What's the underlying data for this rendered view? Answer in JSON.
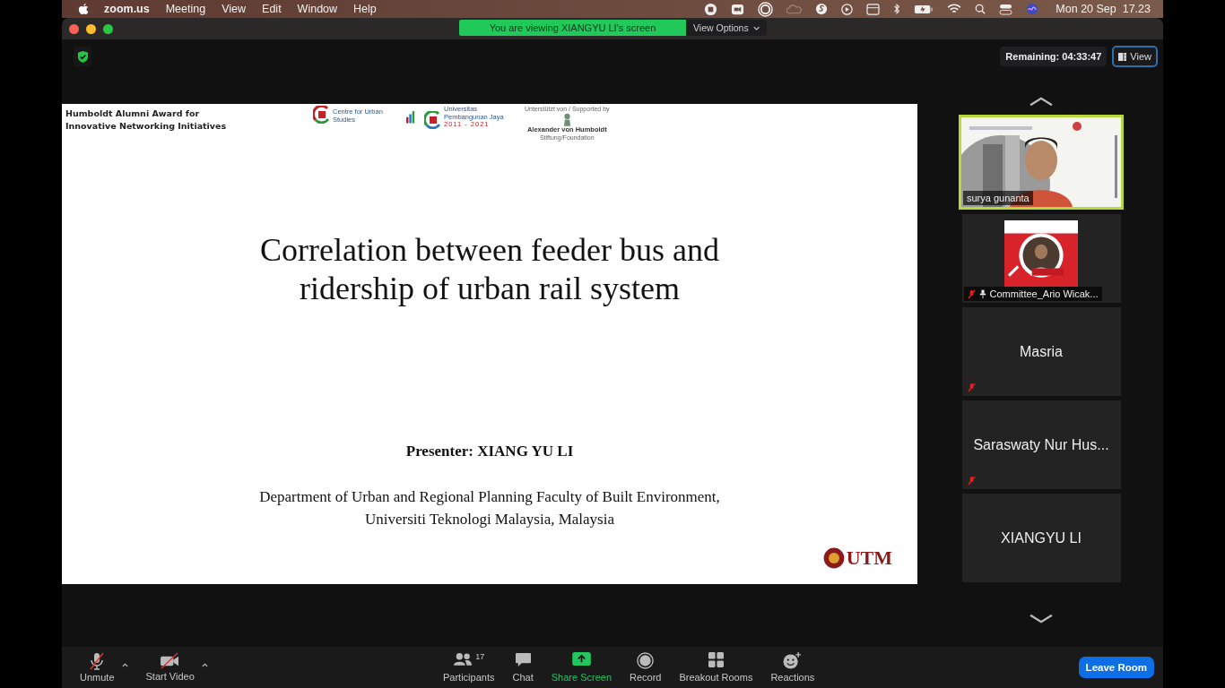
{
  "menu_bar": {
    "app_name": "zoom.us",
    "menus": [
      "Meeting",
      "View",
      "Edit",
      "Window",
      "Help"
    ],
    "clock": "Mon 20 Sep  17.23"
  },
  "banner": {
    "text": "You are viewing XIANGYU LI's screen",
    "view_options": "View Options"
  },
  "top_bar": {
    "remaining": "Remaining: 04:33:47",
    "view_button": "View"
  },
  "slide": {
    "header": [
      "Humboldt Alumni Award for",
      "Innovative Networking Initiatives"
    ],
    "logos": [
      {
        "kind": "urban",
        "label": "Centre for Urban Studies"
      },
      {
        "kind": "university",
        "label": "Universitas Pembangunan Jaya",
        "years": "2011 - 2021"
      },
      {
        "kind": "humboldt",
        "caption": "Unterstützt von / Supported by",
        "label": "Alexander von Humboldt",
        "sub": "Stiftung/Foundation"
      }
    ],
    "title": [
      "Correlation between feeder bus and",
      "ridership of urban rail system"
    ],
    "presenter": "Presenter: XIANG YU LI",
    "affiliation": [
      "Department of Urban and Regional Planning Faculty of Built Environment,",
      "Universiti Teknologi Malaysia, Malaysia"
    ],
    "corner_logo": "UTM"
  },
  "gallery": [
    {
      "kind": "video",
      "name": "surya gunanta",
      "speaking": true,
      "muted": false,
      "pinned": false
    },
    {
      "kind": "video",
      "name": "Committee_Ario Wicak...",
      "speaking": false,
      "muted": true,
      "pinned": true
    },
    {
      "kind": "name",
      "name": "Masria",
      "speaking": false,
      "muted": true,
      "pinned": false
    },
    {
      "kind": "name",
      "name": "Saraswaty Nur Hus...",
      "speaking": false,
      "muted": true,
      "pinned": false
    },
    {
      "kind": "name",
      "name": "XIANGYU LI",
      "speaking": false,
      "muted": false,
      "pinned": false
    }
  ],
  "toolbar": {
    "left": [
      {
        "kind": "mic",
        "label": "Unmute",
        "off": true
      },
      {
        "kind": "camera",
        "label": "Start Video",
        "off": true
      }
    ],
    "center": [
      {
        "kind": "participants",
        "label": "Participants",
        "count": "17"
      },
      {
        "kind": "chat",
        "label": "Chat"
      },
      {
        "kind": "share",
        "label": "Share Screen"
      },
      {
        "kind": "record",
        "label": "Record"
      },
      {
        "kind": "breakout",
        "label": "Breakout Rooms"
      },
      {
        "kind": "reactions",
        "label": "Reactions"
      }
    ],
    "leave": "Leave Room"
  }
}
